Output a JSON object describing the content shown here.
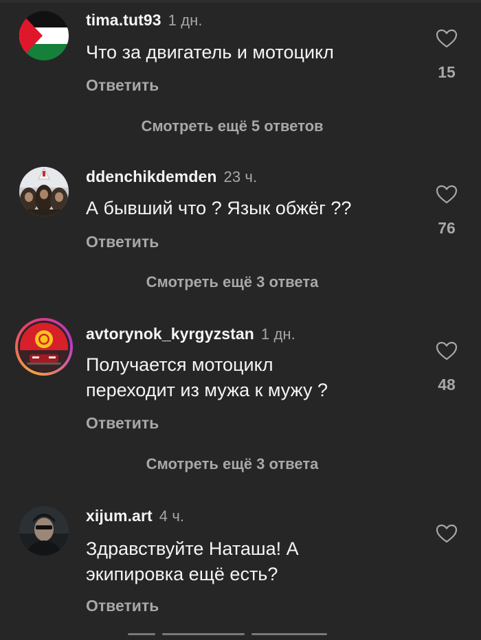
{
  "comments": [
    {
      "username": "tima.tut93",
      "time": "1 дн.",
      "text": "Что за двигатель и мотоцикл",
      "reply": "Ответить",
      "likes": "15",
      "more_replies": "Смотреть ещё 5 ответов",
      "avatar": "palestine-flag"
    },
    {
      "username": "ddenchikdemden",
      "time": "23 ч.",
      "text": "А бывший что ? Язык обжёг ??",
      "reply": "Ответить",
      "likes": "76",
      "more_replies": "Смотреть ещё 3 ответа",
      "avatar": "monkeys-photo"
    },
    {
      "username": "avtorynok_kyrgyzstan",
      "time": "1 дн.",
      "text_line1": "Получается мотоцикл",
      "text_line2": "переходит из мужа к мужу ?",
      "reply": "Ответить",
      "likes": "48",
      "more_replies": "Смотреть ещё 3 ответа",
      "avatar": "kyrgyzstan-flag-car"
    },
    {
      "username": "xijum.art",
      "time": "4 ч.",
      "text_line1": "Здравствуйте Наташа! А",
      "text_line2": "экипировка ещё есть?",
      "reply": "Ответить",
      "likes": "",
      "avatar": "man-photo"
    }
  ],
  "colors": {
    "background": "#262626",
    "text_primary": "#f5f5f5",
    "text_secondary": "#a8a8a8"
  }
}
